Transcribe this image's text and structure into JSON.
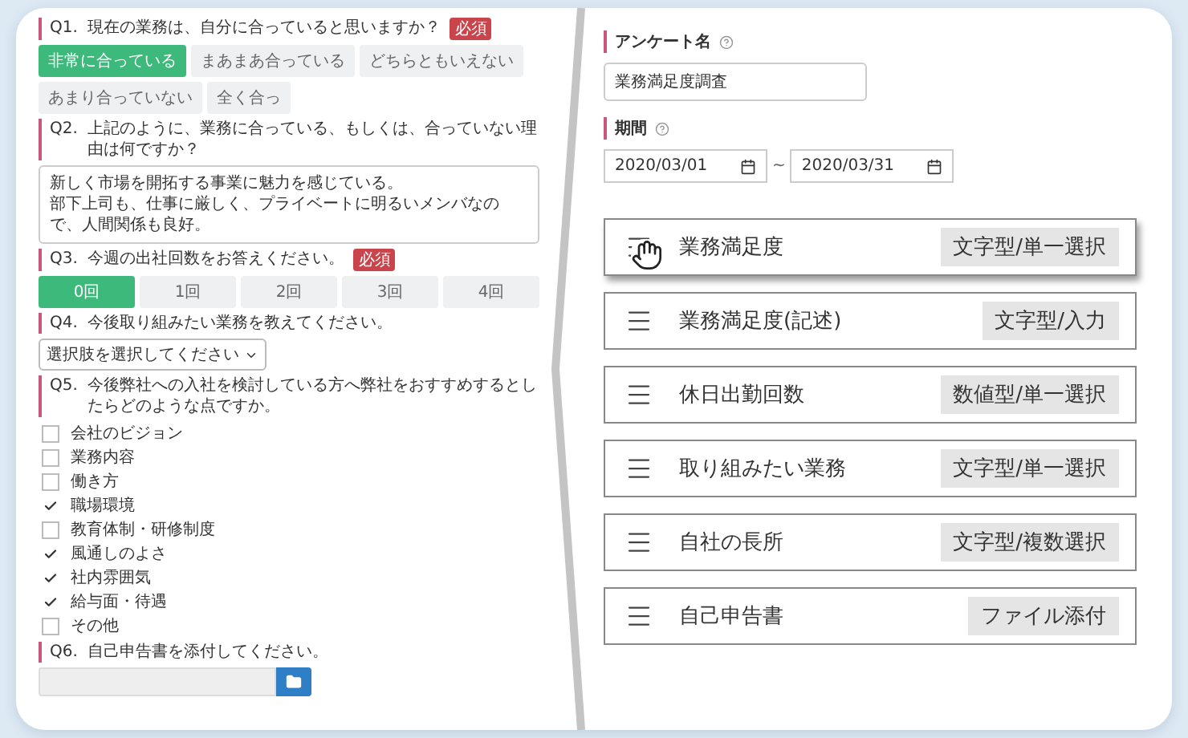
{
  "survey_preview": {
    "questions": [
      {
        "kind": "choice",
        "number": "Q1.",
        "text": "現在の業務は、自分に合っていると思いますか？",
        "required_badge": "必須",
        "options": [
          {
            "label": "非常に合っている",
            "selected": true
          },
          {
            "label": "まあまあ合っている",
            "selected": false
          },
          {
            "label": "どちらともいえない",
            "selected": false
          },
          {
            "label": "あまり合っていない",
            "selected": false
          },
          {
            "label": "全く合っ",
            "selected": false
          }
        ]
      },
      {
        "kind": "textarea",
        "number": "Q2.",
        "text": "上記のように、業務に合っている、もしくは、合っていない理由は何ですか？",
        "answer_lines": [
          "新しく市場を開拓する事業に魅力を感じている。",
          "部下上司も、仕事に厳しく、プライベートに明るいメンバなので、人間関係も良好。"
        ]
      },
      {
        "kind": "choice",
        "number": "Q3.",
        "text": "今週の出社回数をお答えください。",
        "required_badge": "必須",
        "options": [
          {
            "label": "0回",
            "selected": true
          },
          {
            "label": "1回",
            "selected": false
          },
          {
            "label": "2回",
            "selected": false
          },
          {
            "label": "3回",
            "selected": false
          },
          {
            "label": "4回",
            "selected": false
          }
        ]
      },
      {
        "kind": "select",
        "number": "Q4.",
        "text": "今後取り組みたい業務を教えてください。",
        "placeholder": "選択肢を選択してください"
      },
      {
        "kind": "checkbox",
        "number": "Q5.",
        "text": "今後弊社への入社を検討している方へ弊社をおすすめするとしたらどのような点ですか。",
        "options": [
          {
            "label": "会社のビジョン",
            "checked": false
          },
          {
            "label": "業務内容",
            "checked": false
          },
          {
            "label": "働き方",
            "checked": false
          },
          {
            "label": "職場環境",
            "checked": true
          },
          {
            "label": "教育体制・研修制度",
            "checked": false
          },
          {
            "label": "風通しのよさ",
            "checked": true
          },
          {
            "label": "社内雰囲気",
            "checked": true
          },
          {
            "label": "給与面・待遇",
            "checked": true
          },
          {
            "label": "その他",
            "checked": false
          }
        ]
      },
      {
        "kind": "file",
        "number": "Q6.",
        "text": "自己申告書を添付してください。"
      }
    ]
  },
  "editor": {
    "name_label": "アンケート名",
    "name_value": "業務満足度調査",
    "period_label": "期間",
    "start_date": "2020/03/01",
    "separator": "~",
    "end_date": "2020/03/31",
    "items": [
      {
        "title": "業務満足度",
        "type": "文字型/単一選択",
        "grabbed": true
      },
      {
        "title": "業務満足度(記述)",
        "type": "文字型/入力",
        "grabbed": false
      },
      {
        "title": "休日出勤回数",
        "type": "数値型/単一選択",
        "grabbed": false
      },
      {
        "title": "取り組みたい業務",
        "type": "文字型/単一選択",
        "grabbed": false
      },
      {
        "title": "自社の長所",
        "type": "文字型/複数選択",
        "grabbed": false
      },
      {
        "title": "自己申告書",
        "type": "ファイル添付",
        "grabbed": false
      }
    ]
  }
}
